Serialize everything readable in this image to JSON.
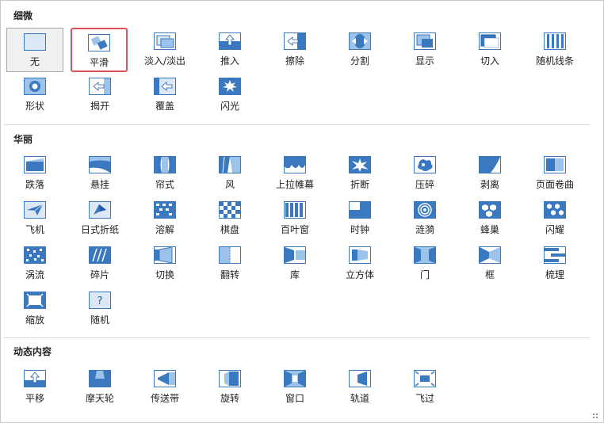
{
  "sections": [
    {
      "title": "细微",
      "items": [
        "无",
        "平滑",
        "淡入/淡出",
        "推入",
        "擦除",
        "分割",
        "显示",
        "切入",
        "随机线条",
        "形状",
        "揭开",
        "覆盖",
        "闪光"
      ]
    },
    {
      "title": "华丽",
      "items": [
        "跌落",
        "悬挂",
        "帘式",
        "风",
        "上拉帷幕",
        "折断",
        "压碎",
        "剥离",
        "页面卷曲",
        "飞机",
        "日式折纸",
        "溶解",
        "棋盘",
        "百叶窗",
        "时钟",
        "涟漪",
        "蜂巢",
        "闪耀",
        "涡流",
        "碎片",
        "切换",
        "翻转",
        "库",
        "立方体",
        "门",
        "框",
        "梳理",
        "缩放",
        "随机"
      ]
    },
    {
      "title": "动态内容",
      "items": [
        "平移",
        "摩天轮",
        "传送带",
        "旋转",
        "窗口",
        "轨道",
        "飞过"
      ]
    }
  ],
  "icons": {
    "无": "none-icon",
    "平滑": "morph-icon",
    "淡入/淡出": "fade-icon",
    "推入": "push-icon",
    "擦除": "wipe-icon",
    "分割": "split-icon",
    "显示": "reveal-icon",
    "切入": "cut-icon",
    "随机线条": "random-bars-icon",
    "形状": "shape-icon",
    "揭开": "uncover-icon",
    "覆盖": "cover-icon",
    "闪光": "flash-icon",
    "跌落": "fall-over-icon",
    "悬挂": "drape-icon",
    "帘式": "curtains-icon",
    "风": "wind-icon",
    "上拉帷幕": "prestige-icon",
    "折断": "fracture-icon",
    "压碎": "crush-icon",
    "剥离": "peel-off-icon",
    "页面卷曲": "page-curl-icon",
    "飞机": "airplane-icon",
    "日式折纸": "origami-icon",
    "溶解": "dissolve-icon",
    "棋盘": "checkerboard-icon",
    "百叶窗": "blinds-icon",
    "时钟": "clock-icon",
    "涟漪": "ripple-icon",
    "蜂巢": "honeycomb-icon",
    "闪耀": "glitter-icon",
    "涡流": "vortex-icon",
    "碎片": "shred-icon",
    "切换": "switch-icon",
    "翻转": "flip-icon",
    "库": "gallery-icon",
    "立方体": "cube-icon",
    "门": "doors-icon",
    "框": "box-icon",
    "梳理": "comb-icon",
    "缩放": "zoom-icon",
    "随机": "random-icon",
    "平移": "pan-icon",
    "摩天轮": "ferris-wheel-icon",
    "传送带": "conveyor-icon",
    "旋转": "rotate-icon",
    "窗口": "window-icon",
    "轨道": "orbit-icon",
    "飞过": "fly-through-icon"
  },
  "selected": "无",
  "focused": "平滑",
  "colors": {
    "accent": "#3a78c0",
    "focus": "#e05060"
  }
}
